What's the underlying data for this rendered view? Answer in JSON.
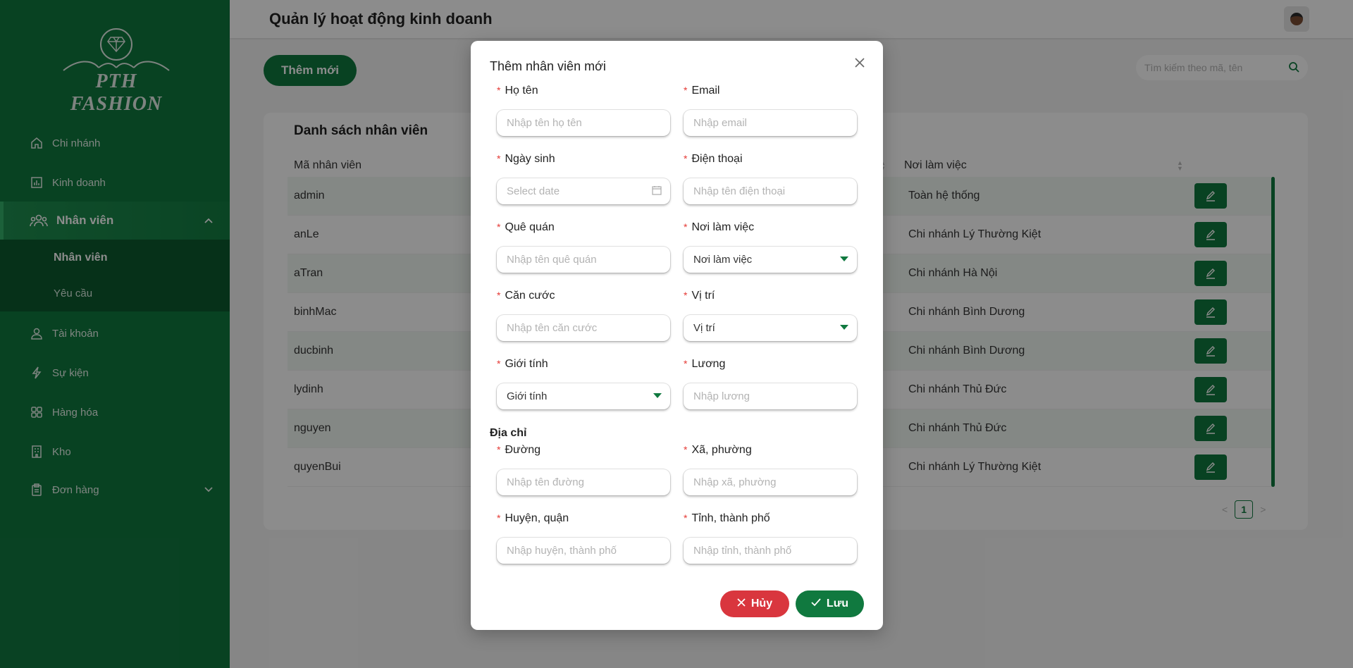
{
  "sidebar": {
    "brand": "PTH FASHION",
    "items": [
      {
        "label": "Chi nhánh",
        "icon": "home-icon"
      },
      {
        "label": "Kinh doanh",
        "icon": "chart-icon"
      },
      {
        "label": "Nhân viên",
        "icon": "users-icon"
      },
      {
        "label": "Tài khoản",
        "icon": "user-icon"
      },
      {
        "label": "Sự kiện",
        "icon": "lightning-icon"
      },
      {
        "label": "Hàng hóa",
        "icon": "grid-icon"
      },
      {
        "label": "Kho",
        "icon": "building-icon"
      },
      {
        "label": "Đơn hàng",
        "icon": "clipboard-icon"
      }
    ],
    "sub_items": [
      {
        "label": "Nhân viên"
      },
      {
        "label": "Yêu cầu"
      }
    ]
  },
  "header": {
    "title": "Quản lý hoạt động kinh doanh"
  },
  "main": {
    "add_label": "Thêm mới",
    "search_placeholder": "Tìm kiếm theo mã, tên",
    "card_title": "Danh sách nhân viên",
    "columns": [
      "Mã nhân viên",
      "Nơi làm việc"
    ],
    "rows": [
      {
        "id": "admin",
        "workplace": "Toàn hệ thống"
      },
      {
        "id": "anLe",
        "workplace": "Chi nhánh Lý Thường Kiệt"
      },
      {
        "id": "aTran",
        "workplace": "Chi nhánh Hà Nội"
      },
      {
        "id": "binhMac",
        "workplace": "Chi nhánh Bình Dương"
      },
      {
        "id": "ducbinh",
        "workplace": "Chi nhánh Bình Dương"
      },
      {
        "id": "lydinh",
        "workplace": "Chi nhánh Thủ Đức"
      },
      {
        "id": "nguyen",
        "workplace": "Chi nhánh Thủ Đức"
      },
      {
        "id": "quyenBui",
        "workplace": "Chi nhánh Lý Thường Kiệt"
      }
    ],
    "page": "1"
  },
  "modal": {
    "title": "Thêm nhân viên mới",
    "fields": {
      "name": {
        "label": "Họ tên",
        "placeholder": "Nhập tên họ tên"
      },
      "email": {
        "label": "Email",
        "placeholder": "Nhập email"
      },
      "dob": {
        "label": "Ngày sinh",
        "placeholder": "Select date"
      },
      "phone": {
        "label": "Điện thoại",
        "placeholder": "Nhập tên điện thoại"
      },
      "hometown": {
        "label": "Quê quán",
        "placeholder": "Nhập tên quê quán"
      },
      "workplace": {
        "label": "Nơi làm việc",
        "value": "Nơi làm việc"
      },
      "id_card": {
        "label": "Căn cước",
        "placeholder": "Nhập tên căn cước"
      },
      "position": {
        "label": "Vị trí",
        "value": "Vị trí"
      },
      "gender": {
        "label": "Giới tính",
        "value": "Giới tính"
      },
      "salary": {
        "label": "Lương",
        "placeholder": "Nhập lương"
      },
      "street": {
        "label": "Đường",
        "placeholder": "Nhập tên đường"
      },
      "ward": {
        "label": "Xã, phường",
        "placeholder": "Nhập xã, phường"
      },
      "district": {
        "label": "Huyện, quận",
        "placeholder": "Nhập huyện, thành phố"
      },
      "province": {
        "label": "Tỉnh, thành phố",
        "placeholder": "Nhập tỉnh, thành phố"
      }
    },
    "address_title": "Địa chỉ",
    "cancel_label": "Hủy",
    "save_label": "Lưu"
  },
  "colors": {
    "primary": "#10793f",
    "danger": "#d9363e",
    "required": "#e53935"
  }
}
